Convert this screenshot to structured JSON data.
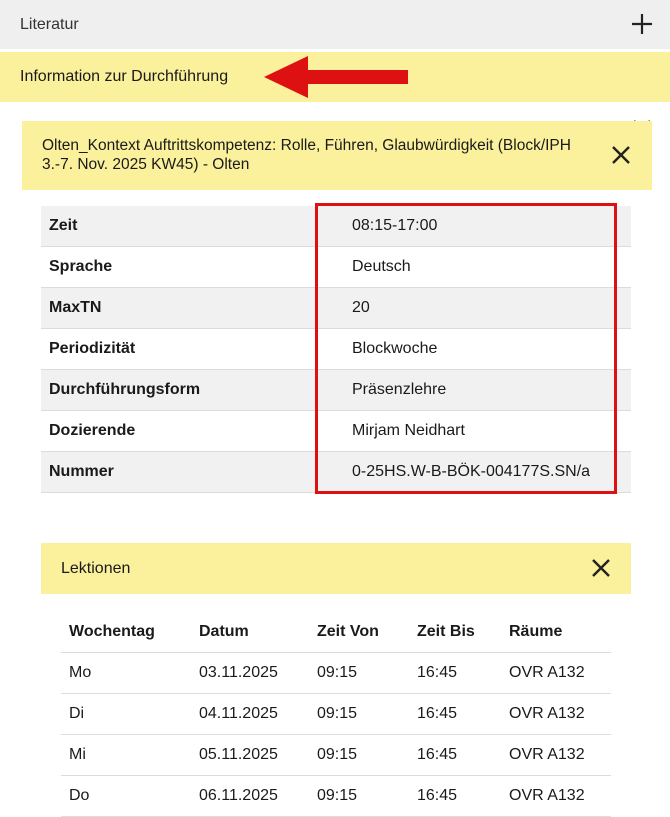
{
  "literatur": {
    "title": "Literatur"
  },
  "info": {
    "title": "Information zur Durchführung"
  },
  "course": {
    "title": "Olten_Kontext Auftrittskompetenz: Rolle, Führen, Glaubwürdigkeit (Block/IPH 3.-7. Nov. 2025 KW45) - Olten"
  },
  "details": [
    {
      "label": "Zeit",
      "value": "08:15-17:00"
    },
    {
      "label": "Sprache",
      "value": "Deutsch"
    },
    {
      "label": "MaxTN",
      "value": "20"
    },
    {
      "label": "Periodizität",
      "value": "Blockwoche"
    },
    {
      "label": "Durchführungsform",
      "value": "Präsenzlehre"
    },
    {
      "label": "Dozierende",
      "value": "Mirjam Neidhart"
    },
    {
      "label": "Nummer",
      "value": "0-25HS.W-B-BÖK-004177S.SN/a"
    }
  ],
  "lektionen": {
    "title": "Lektionen",
    "headers": [
      "Wochentag",
      "Datum",
      "Zeit Von",
      "Zeit Bis",
      "Räume"
    ],
    "rows": [
      [
        "Mo",
        "03.11.2025",
        "09:15",
        "16:45",
        "OVR A132"
      ],
      [
        "Di",
        "04.11.2025",
        "09:15",
        "16:45",
        "OVR A132"
      ],
      [
        "Mi",
        "05.11.2025",
        "09:15",
        "16:45",
        "OVR A132"
      ],
      [
        "Do",
        "06.11.2025",
        "09:15",
        "16:45",
        "OVR A132"
      ]
    ]
  },
  "colors": {
    "highlight": "#fbf09b",
    "annotation_red": "#dd1111",
    "row_alt": "#f1f1f1"
  }
}
